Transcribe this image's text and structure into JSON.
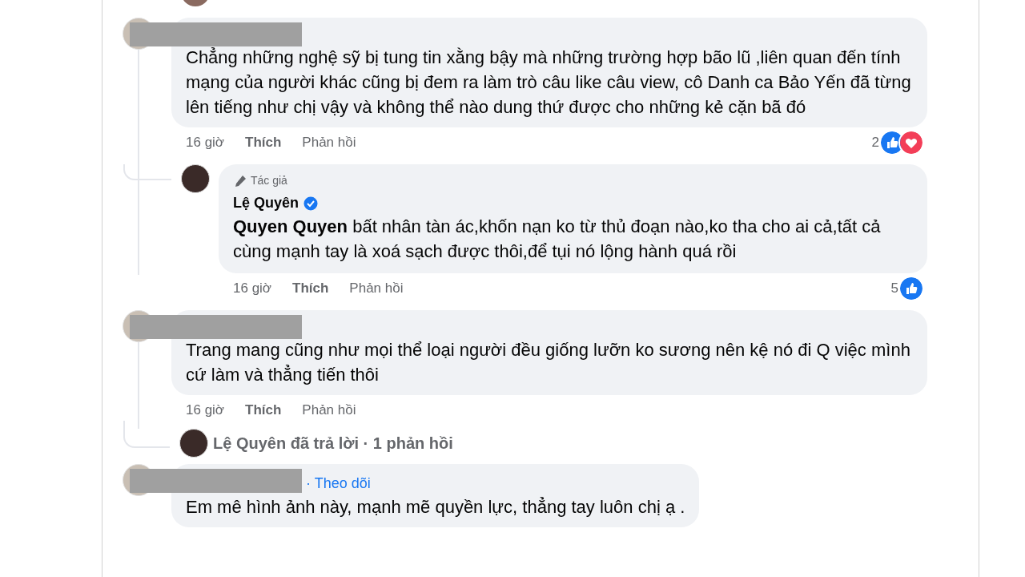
{
  "comments": [
    {
      "redacted": true,
      "text": "Chẳng những nghệ sỹ bị tung tin xằng bậy mà những trường hợp bão lũ ,liên quan đến tính mạng của người khác cũng bị đem ra làm trò câu like câu view, cô Danh ca Bảo Yến đã từng lên tiếng như chị vậy và không thể nào dung thứ được cho những kẻ cặn bã đó",
      "time": "16 giờ",
      "like": "Thích",
      "reply": "Phản hồi",
      "reaction_count": "2",
      "reactions": [
        {
          "kind": "like"
        },
        {
          "kind": "love"
        }
      ],
      "replies": [
        {
          "badge": "Tác giả",
          "author": "Lệ Quyên",
          "verified": true,
          "text": "**Quyen Quyen** bất nhân tàn ác,khốn nạn ko từ thủ đoạn nào,ko tha cho ai cả,tất cả cùng mạnh tay là xoá sạch được thôi,để tụi nó lộng hành quá rồi",
          "time": "16 giờ",
          "like": "Thích",
          "reply": "Phản hồi",
          "reaction_count": "5",
          "reactions": [
            {
              "kind": "like"
            }
          ]
        }
      ]
    },
    {
      "redacted": true,
      "text": "Trang mang cũng như mọi thể loại người đều giống lưỡn ko sương nên kệ nó đi Q việc mình cứ làm và thẳng tiến thôi",
      "time": "16 giờ",
      "like": "Thích",
      "reply": "Phản hồi",
      "replies_summary": "Lệ Quyên đã trả lời · 1 phản hồi"
    },
    {
      "redacted": true,
      "follow": "· Theo dõi",
      "text": "Em mê hình ảnh này, mạnh mẽ quyền lực, thẳng tay luôn chị ạ ."
    }
  ]
}
